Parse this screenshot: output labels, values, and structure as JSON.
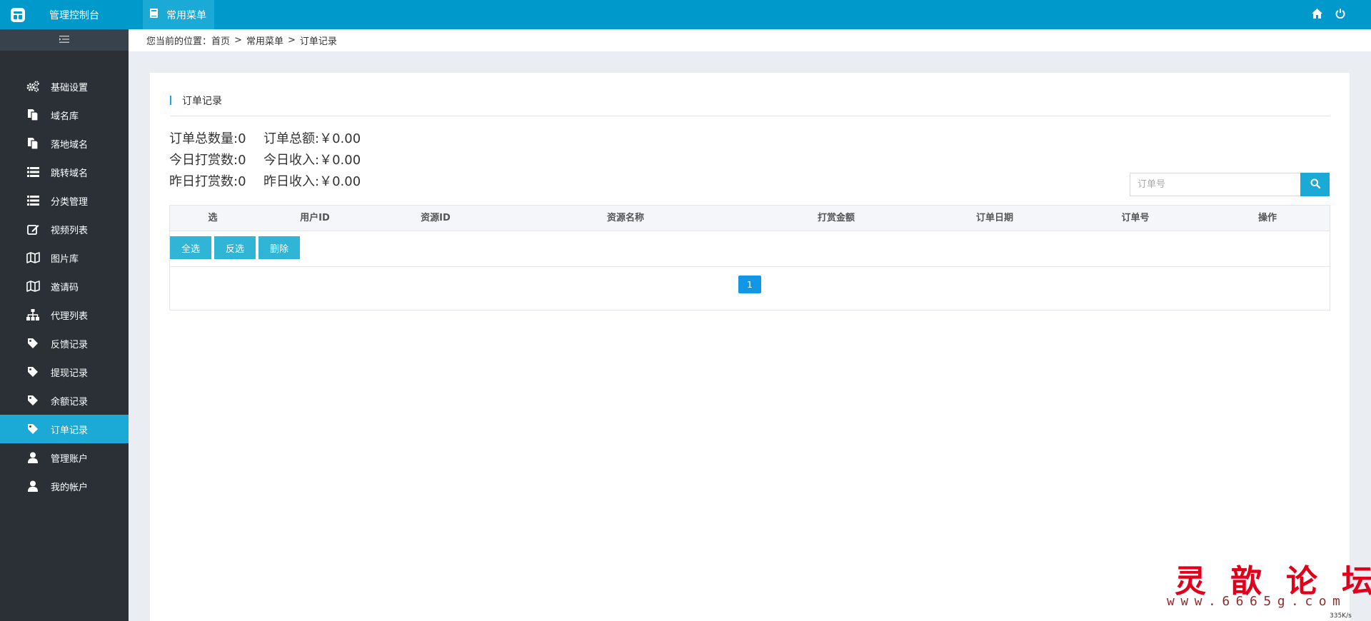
{
  "header": {
    "brand_title": "管理控制台",
    "active_tab": "常用菜单"
  },
  "breadcrumb": {
    "prefix": "您当前的位置：",
    "items": [
      "首页",
      "常用菜单",
      "订单记录"
    ],
    "separator": ">"
  },
  "sidebar": {
    "items": [
      {
        "label": "基础设置",
        "icon": "gears-icon"
      },
      {
        "label": "域名库",
        "icon": "copy-icon"
      },
      {
        "label": "落地域名",
        "icon": "copy-icon"
      },
      {
        "label": "跳转域名",
        "icon": "list-icon"
      },
      {
        "label": "分类管理",
        "icon": "list-icon"
      },
      {
        "label": "视频列表",
        "icon": "edit-icon"
      },
      {
        "label": "图片库",
        "icon": "map-icon"
      },
      {
        "label": "邀请码",
        "icon": "map-icon"
      },
      {
        "label": "代理列表",
        "icon": "sitemap-icon"
      },
      {
        "label": "反馈记录",
        "icon": "tag-icon"
      },
      {
        "label": "提现记录",
        "icon": "tag-icon"
      },
      {
        "label": "余额记录",
        "icon": "tag-icon"
      },
      {
        "label": "订单记录",
        "icon": "tag-icon",
        "active": true
      },
      {
        "label": "管理账户",
        "icon": "user-icon"
      },
      {
        "label": "我的帐户",
        "icon": "user-icon"
      }
    ]
  },
  "panel": {
    "title": "订单记录",
    "stats": [
      {
        "label": "订单总数量:0",
        "value": "订单总额:￥0.00"
      },
      {
        "label": "今日打赏数:0",
        "value": "今日收入:￥0.00"
      },
      {
        "label": "昨日打赏数:0",
        "value": "昨日收入:￥0.00"
      }
    ],
    "search": {
      "placeholder": "订单号"
    },
    "table": {
      "columns": [
        "选",
        "用户ID",
        "资源ID",
        "资源名称",
        "打赏金额",
        "订单日期",
        "订单号",
        "操作"
      ]
    },
    "buttons": {
      "select_all": "全选",
      "invert": "反选",
      "delete": "删除"
    },
    "pagination": {
      "current": "1"
    }
  },
  "watermark": {
    "title": "灵歆论坛",
    "url": "www.6665g.com",
    "speed": "335K/s"
  },
  "colors": {
    "topbar": "#0099cc",
    "accent": "#1ba9d6",
    "sidebar_bg": "#2a3036",
    "button": "#31b5d7",
    "page_active": "#1296e6",
    "watermark": "#e0001b"
  }
}
